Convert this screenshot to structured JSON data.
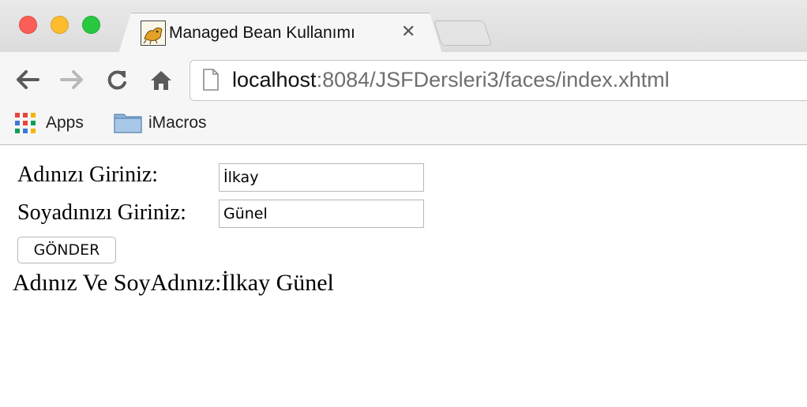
{
  "window": {
    "tab_title": "Managed Bean Kullanımı",
    "tab_close": "✕"
  },
  "toolbar": {
    "url_host": "localhost",
    "url_rest": ":8084/JSFDersleri3/faces/index.xhtml"
  },
  "bookmarks": [
    {
      "label": "Apps",
      "icon": "apps-grid-icon"
    },
    {
      "label": "iMacros",
      "icon": "folder-icon"
    }
  ],
  "form": {
    "name_label": "Adınızı Giriniz:",
    "name_value": "İlkay",
    "surname_label": "Soyadınızı Giriniz:",
    "surname_value": "Günel",
    "submit_label": "GÖNDER"
  },
  "result": {
    "text": "Adınız Ve SoyAdınız:İlkay Günel"
  },
  "colors": {
    "close": "#fc5f57",
    "minimize": "#fdbc2e",
    "maximize": "#28c840"
  }
}
